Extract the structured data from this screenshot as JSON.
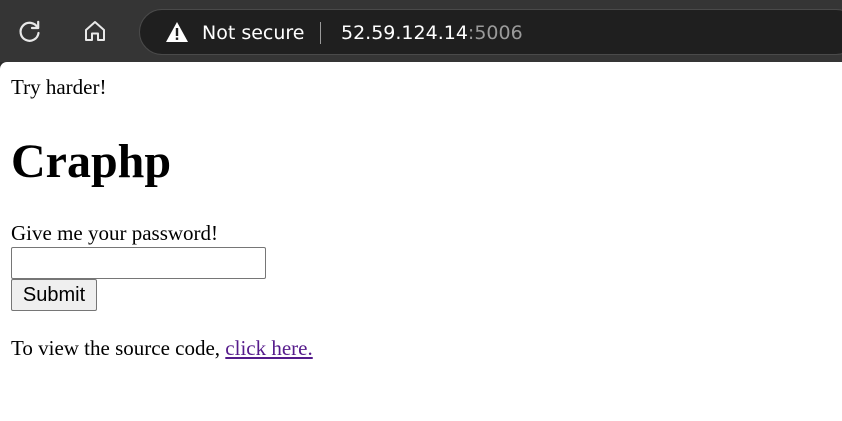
{
  "browser": {
    "security_label": "Not secure",
    "url_host": "52.59.124.14",
    "url_port": ":5006",
    "icons": {
      "reload": "reload-icon",
      "home": "home-icon",
      "warning": "warning-triangle-icon"
    }
  },
  "page": {
    "message": "Try harder!",
    "title": "Craphp",
    "prompt": "Give me your password!",
    "password_value": "",
    "submit_label": "Submit",
    "source_text": "To view the source code, ",
    "source_link": "click here."
  },
  "colors": {
    "toolbar_bg": "#353535",
    "address_bg": "#1f1f1f",
    "visited_link": "#551a8b"
  }
}
